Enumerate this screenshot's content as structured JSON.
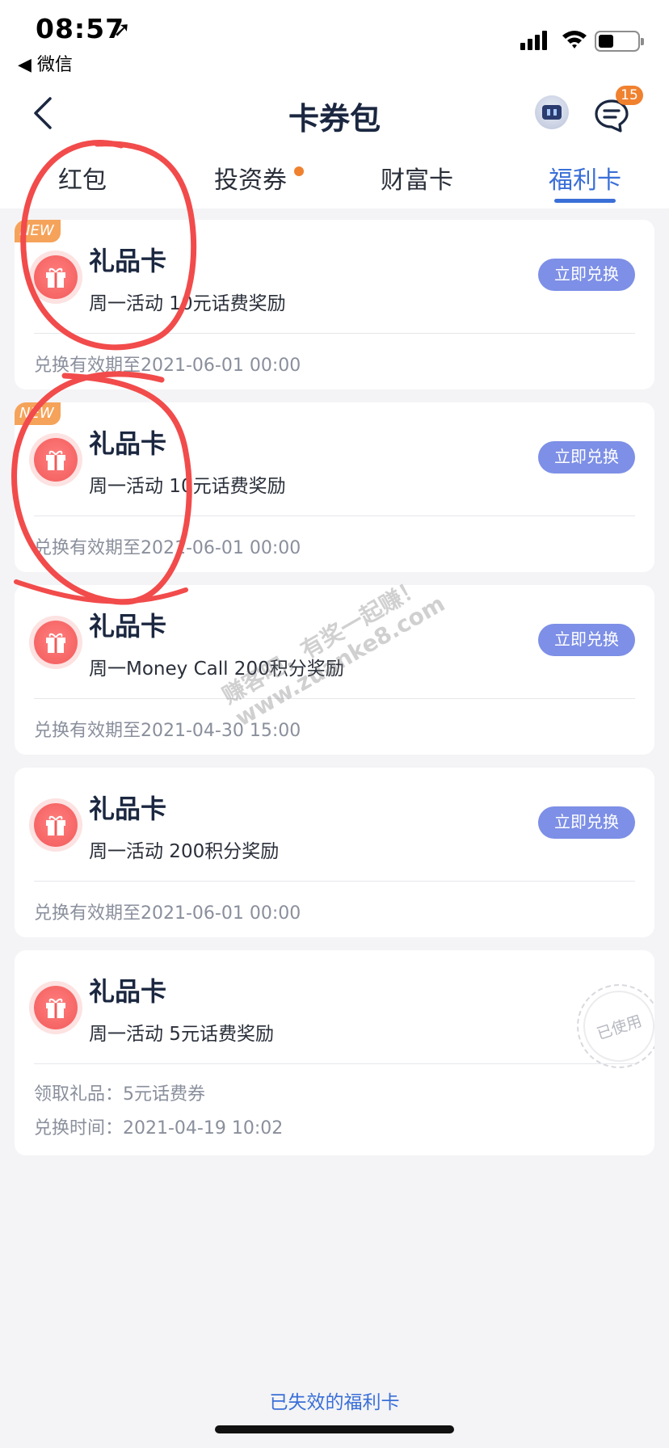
{
  "status_bar": {
    "time": "08:57",
    "location_glyph": "➚",
    "back_app": "◀ 微信",
    "icons": [
      "signal-icon",
      "wifi-icon",
      "battery-icon"
    ]
  },
  "nav": {
    "title": "卡券包",
    "back_icon": "chevron-left-icon",
    "robot_icon": "robot-assistant-icon",
    "message_icon": "message-icon",
    "message_badge": "15"
  },
  "tabs": [
    {
      "label": "红包",
      "active": false
    },
    {
      "label": "投资券",
      "active": false,
      "has_dot": true
    },
    {
      "label": "财富卡",
      "active": false
    },
    {
      "label": "福利卡",
      "active": true
    }
  ],
  "cards": [
    {
      "new_tag": "NEW",
      "title": "礼品卡",
      "subtitle": "周一活动 10元话费奖励",
      "button": "立即兑换",
      "meta_lines": [
        "兑换有效期至2021-06-01 00:00"
      ]
    },
    {
      "new_tag": "NEW",
      "title": "礼品卡",
      "subtitle": "周一活动 10元话费奖励",
      "button": "立即兑换",
      "meta_lines": [
        "兑换有效期至2021-06-01 00:00"
      ]
    },
    {
      "title": "礼品卡",
      "subtitle": "周一Money Call 200积分奖励",
      "button": "立即兑换",
      "meta_lines": [
        "兑换有效期至2021-04-30 15:00"
      ]
    },
    {
      "title": "礼品卡",
      "subtitle": "周一活动 200积分奖励",
      "button": "立即兑换",
      "meta_lines": [
        "兑换有效期至2021-06-01 00:00"
      ]
    },
    {
      "title": "礼品卡",
      "subtitle": "周一活动 5元话费奖励",
      "stamp": "已使用",
      "meta_lines": [
        "领取礼品：5元话费券",
        "兑换时间：2021-04-19 10:02"
      ]
    }
  ],
  "footer": {
    "link": "已失效的福利卡"
  },
  "watermark": {
    "line1": "赚客吧，有奖一起赚！",
    "line2": "www.zuanke8.com"
  },
  "colors": {
    "accent_blue": "#3a6fd8",
    "button_blue": "#7d8fe6",
    "badge_orange": "#f0812f",
    "new_tag_orange": "#f5a35a",
    "gift_red": "#f25a5a",
    "annotation_red": "#f24b4b"
  }
}
